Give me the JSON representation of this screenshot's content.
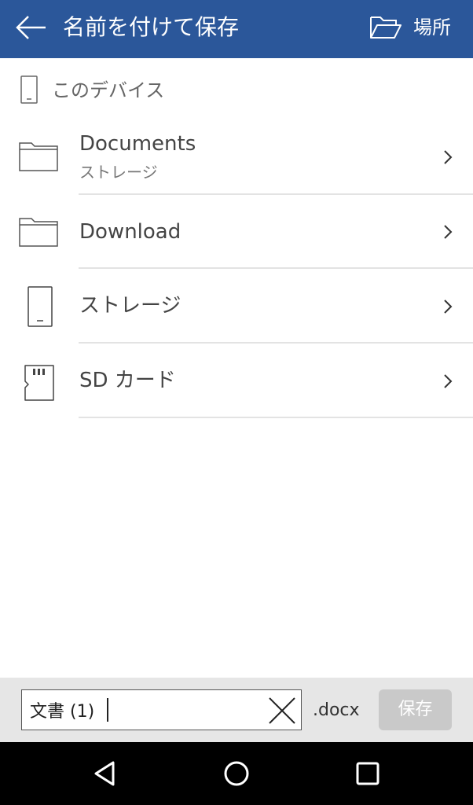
{
  "appbar": {
    "title": "名前を付けて保存",
    "location_label": "場所",
    "icons": {
      "back": "arrow-left-icon",
      "location": "folder-open-icon"
    }
  },
  "section": {
    "label": "このデバイス",
    "icon": "phone-icon"
  },
  "items": [
    {
      "label": "Documents",
      "sublabel": "ストレージ",
      "icon": "folder-icon"
    },
    {
      "label": "Download",
      "sublabel": "",
      "icon": "folder-icon"
    },
    {
      "label": "ストレージ",
      "sublabel": "",
      "icon": "phone-icon"
    },
    {
      "label": "SD カード",
      "sublabel": "",
      "icon": "sd-card-icon"
    }
  ],
  "savebar": {
    "filename_value": "文書 (1)",
    "extension": ".docx",
    "save_label": "保存",
    "icons": {
      "clear": "close-icon"
    }
  },
  "navbar": {
    "icons": [
      "back-triangle-icon",
      "home-circle-icon",
      "recents-square-icon"
    ]
  },
  "colors": {
    "accent": "#2b579a",
    "save_disabled": "#c9c9c9"
  }
}
